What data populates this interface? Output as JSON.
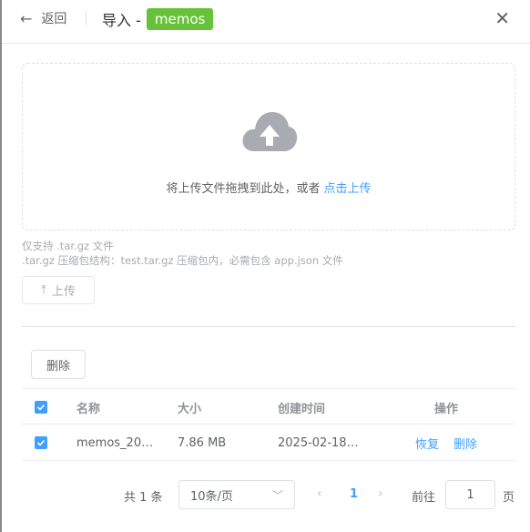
{
  "header": {
    "back_label": "返回",
    "title_prefix": "导入 -",
    "title_tag": "memos"
  },
  "upload": {
    "drop_text": "将上传文件拖拽到此处，或者",
    "drop_link": "点击上传",
    "tip_1": "仅支持 .tar.gz 文件",
    "tip_2": ".tar.gz 压缩包结构：test.tar.gz 压缩包内，必需包含 app.json 文件",
    "upload_button": "上传"
  },
  "toolbar": {
    "delete_button": "删除"
  },
  "table": {
    "columns": {
      "name": "名称",
      "size": "大小",
      "created": "创建时间",
      "actions": "操作"
    },
    "rows": [
      {
        "name": "memos_20…",
        "size": "7.86 MB",
        "created": "2025-02-18 …",
        "restore": "恢复",
        "delete": "删除"
      }
    ]
  },
  "pagination": {
    "total": "共 1 条",
    "page_size": "10条/页",
    "current_page": "1",
    "goto_label": "前往",
    "goto_value": "1",
    "goto_suffix": "页"
  },
  "colors": {
    "accent": "#409eff",
    "tag": "#67c23a"
  }
}
